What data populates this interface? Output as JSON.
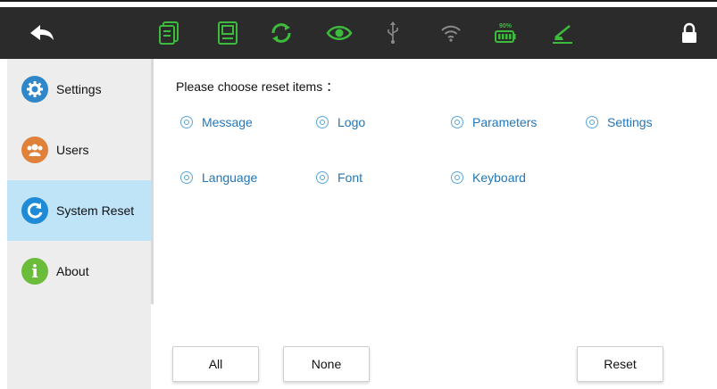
{
  "toolbar": {
    "icons": [
      "back-arrow-icon",
      "document-icon",
      "device-icon",
      "sync-icon",
      "eye-icon",
      "usb-icon",
      "wifi-icon",
      "battery-icon",
      "printer-icon",
      "lock-icon"
    ],
    "battery_label": "90%",
    "colors": {
      "bar": "#2b2b2b",
      "green": "#3dbb3d",
      "gray": "#8a8a8a",
      "white": "#ffffff"
    }
  },
  "sidebar": {
    "items": [
      {
        "label": "Settings",
        "icon": "gear-icon",
        "color": "#2f86c9"
      },
      {
        "label": "Users",
        "icon": "users-icon",
        "color": "#e0813a"
      },
      {
        "label": "System Reset",
        "icon": "reset-icon",
        "color": "#1f8ad6",
        "active": true
      },
      {
        "label": "About",
        "icon": "info-icon",
        "color": "#6cbc3c"
      }
    ]
  },
  "main": {
    "prompt": "Please choose reset items ：",
    "options": [
      "Message",
      "Logo",
      "Parameters",
      "Settings",
      "Language",
      "Font",
      "Keyboard"
    ]
  },
  "buttons": {
    "all": "All",
    "none": "None",
    "reset": "Reset"
  }
}
